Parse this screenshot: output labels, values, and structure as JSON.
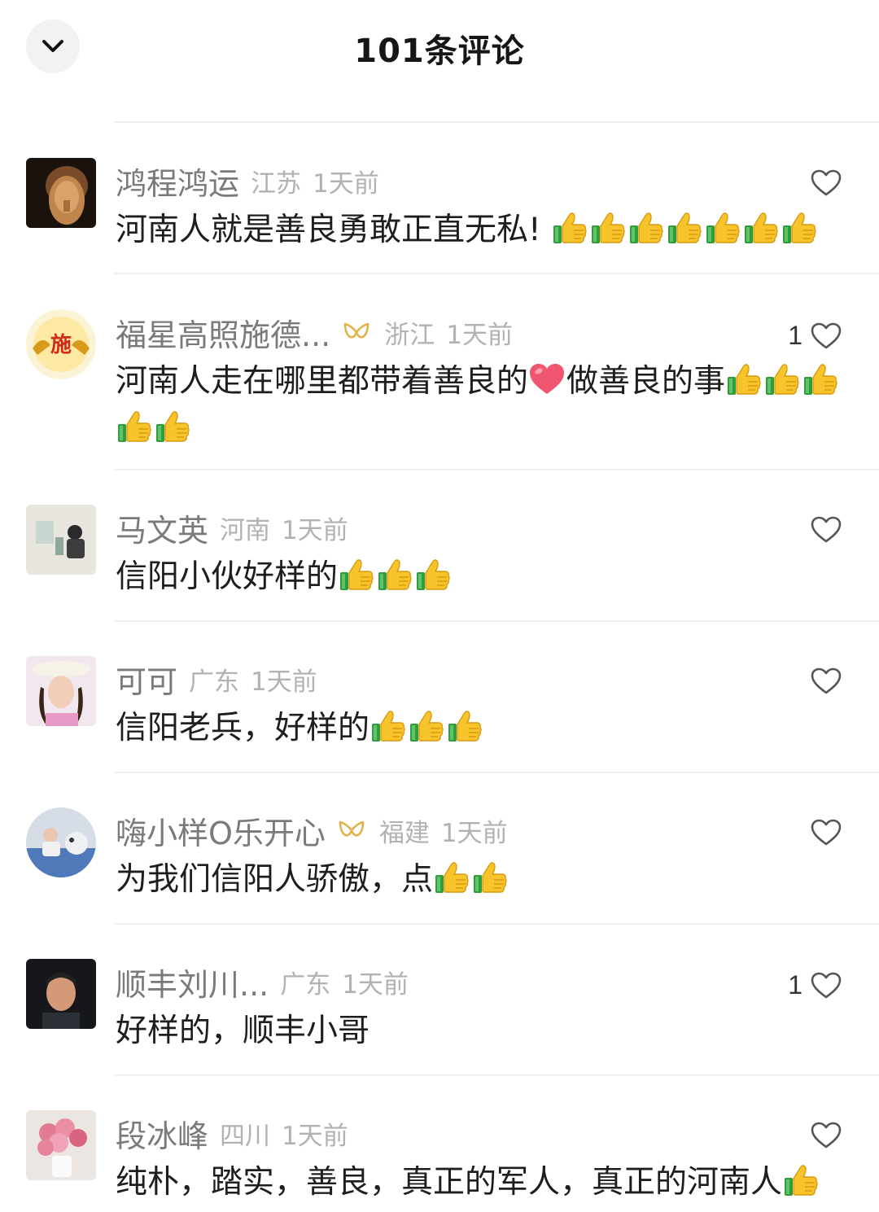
{
  "header": {
    "title": "101条评论",
    "collapse_icon": "chevron-down-icon"
  },
  "comments": [
    {
      "username": "鸿程鸿运",
      "badge": false,
      "region": "江苏",
      "time": "1天前",
      "likes": "",
      "segments": [
        {
          "type": "text",
          "value": "河南人就是善良勇敢正直无私!  "
        },
        {
          "type": "emoji",
          "name": "thumbs-up",
          "count": 7
        }
      ]
    },
    {
      "username": "福星高照施德...",
      "badge": true,
      "region": "浙江",
      "time": "1天前",
      "likes": "1",
      "segments": [
        {
          "type": "text",
          "value": "河南人走在哪里都带着善良的"
        },
        {
          "type": "emoji",
          "name": "heart",
          "count": 1
        },
        {
          "type": "text",
          "value": "做善良的事"
        },
        {
          "type": "emoji",
          "name": "thumbs-up",
          "count": 5
        }
      ]
    },
    {
      "username": "马文英",
      "badge": false,
      "region": "河南",
      "time": "1天前",
      "likes": "",
      "segments": [
        {
          "type": "text",
          "value": "信阳小伙好样的"
        },
        {
          "type": "emoji",
          "name": "thumbs-up",
          "count": 3
        }
      ]
    },
    {
      "username": "可可",
      "badge": false,
      "region": "广东",
      "time": "1天前",
      "likes": "",
      "segments": [
        {
          "type": "text",
          "value": "信阳老兵，好样的"
        },
        {
          "type": "emoji",
          "name": "thumbs-up",
          "count": 3
        }
      ]
    },
    {
      "username": "嗨小样O乐开心",
      "badge": true,
      "region": "福建",
      "time": "1天前",
      "likes": "",
      "segments": [
        {
          "type": "text",
          "value": "为我们信阳人骄傲，点"
        },
        {
          "type": "emoji",
          "name": "thumbs-up",
          "count": 2
        }
      ]
    },
    {
      "username": "顺丰刘川...",
      "badge": false,
      "region": "广东",
      "time": "1天前",
      "likes": "1",
      "segments": [
        {
          "type": "text",
          "value": "好样的，顺丰小哥"
        }
      ]
    },
    {
      "username": "段冰峰",
      "badge": false,
      "region": "四川",
      "time": "1天前",
      "likes": "",
      "segments": [
        {
          "type": "text",
          "value": "纯朴，踏实，善良，真正的军人，真正的河南人"
        },
        {
          "type": "emoji",
          "name": "thumbs-up",
          "count": 1
        }
      ]
    }
  ]
}
